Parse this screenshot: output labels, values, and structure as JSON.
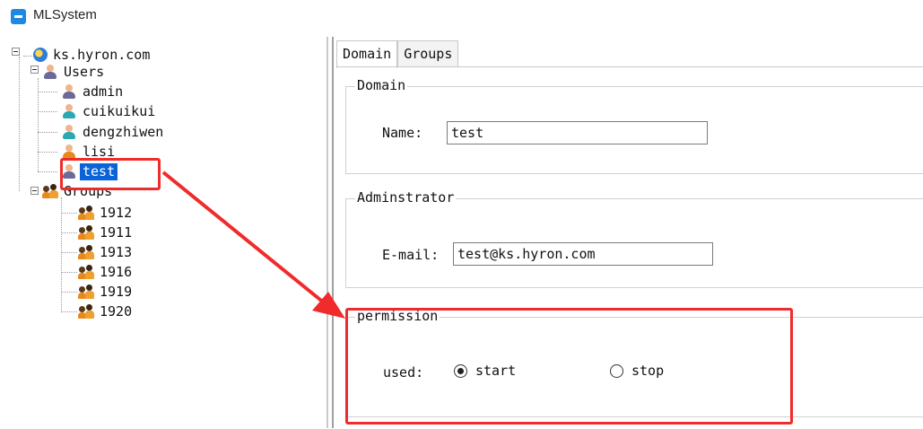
{
  "window": {
    "title": "MLSystem"
  },
  "tree": {
    "root": "ks.hyron.com",
    "users_label": "Users",
    "users": [
      "admin",
      "cuikuikui",
      "dengzhiwen",
      "lisi",
      "test"
    ],
    "selected_user": "test",
    "groups_label": "Groups",
    "groups": [
      "1912",
      "1911",
      "1913",
      "1916",
      "1919",
      "1920"
    ]
  },
  "tabs": [
    "Domain",
    "Groups"
  ],
  "domain_section": {
    "title": "Domain",
    "name_label": "Name:",
    "name_value": "test"
  },
  "admin_section": {
    "title": "Adminstrator",
    "email_label": "E-mail:",
    "email_value": "test@ks.hyron.com"
  },
  "permission_section": {
    "title": "permission",
    "used_label": "used:",
    "options": [
      {
        "label": "start",
        "checked": true
      },
      {
        "label": "stop",
        "checked": false
      }
    ]
  },
  "colors": {
    "selection": "#0a64d8",
    "annotation": "#f02b2b",
    "app_icon": "#1e88e5"
  }
}
